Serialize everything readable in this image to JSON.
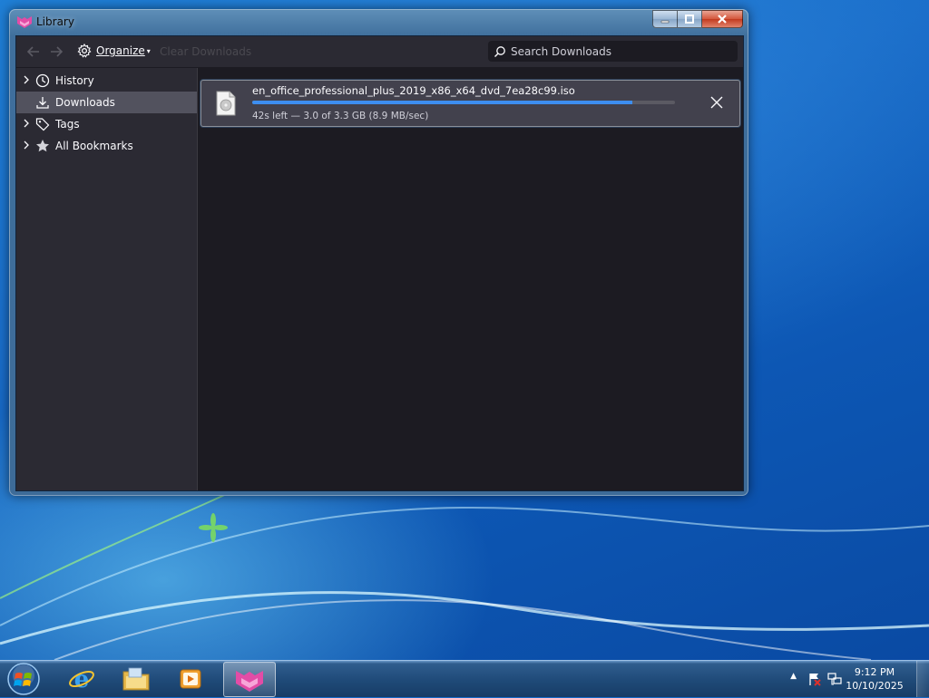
{
  "window": {
    "title": "Library",
    "icons": {
      "app": "library-app-icon",
      "minimize": "minimize-icon",
      "maximize": "maximize-icon",
      "close": "close-icon"
    }
  },
  "toolbar": {
    "back_icon": "arrow-left-icon",
    "forward_icon": "arrow-right-icon",
    "organize_label": "Organize",
    "clear_downloads_label": "Clear Downloads",
    "search_placeholder": "Search Downloads"
  },
  "sidebar": {
    "items": [
      {
        "label": "History",
        "icon": "clock-icon",
        "expandable": true,
        "selected": false
      },
      {
        "label": "Downloads",
        "icon": "download-icon",
        "expandable": false,
        "selected": true
      },
      {
        "label": "Tags",
        "icon": "tag-icon",
        "expandable": true,
        "selected": false
      },
      {
        "label": "All Bookmarks",
        "icon": "star-icon",
        "expandable": true,
        "selected": false
      }
    ]
  },
  "downloads": [
    {
      "filename": "en_office_professional_plus_2019_x86_x64_dvd_7ea28c99.iso",
      "status": "42s left — 3.0 of 3.3 GB (8.9 MB/sec)",
      "progress_fraction": 0.9,
      "icon": "disc-image-file-icon"
    }
  ],
  "taskbar": {
    "apps": [
      "internet-explorer-icon",
      "file-explorer-icon",
      "media-player-icon",
      "library-app-icon"
    ],
    "active_app": "library-app-icon",
    "clock_time": "9:12 PM",
    "clock_date": "10/10/2025"
  },
  "colors": {
    "accent": "#3d8ef0",
    "window_bg": "#1c1b22",
    "toolbar_bg": "#2b2a33",
    "selected_bg": "#52525e",
    "brand": "#e34ca6"
  }
}
